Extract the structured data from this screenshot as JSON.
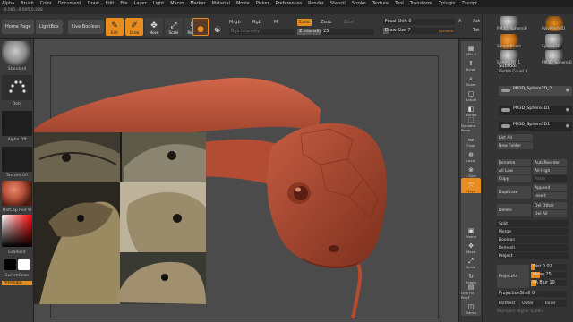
{
  "menu": [
    "Alpha",
    "Brush",
    "Color",
    "Document",
    "Draw",
    "Edit",
    "File",
    "Layer",
    "Light",
    "Macro",
    "Marker",
    "Material",
    "Movie",
    "Picker",
    "Preferences",
    "Render",
    "Stencil",
    "Stroke",
    "Texture",
    "Tool",
    "Transform",
    "Zplugin",
    "Zscript"
  ],
  "coords": "-0.081,-0.695,0.288",
  "toolbar": {
    "home": "Home Page",
    "lightbox": "LightBox",
    "live_boolean": "Live Boolean",
    "edit": "Edit",
    "draw": "Draw",
    "move": "Move",
    "scale": "Scale",
    "rotate": "Rotate",
    "mrgb": "Mrgb",
    "rgb": "Rgb",
    "m": "M",
    "rgb_intensity": "Rgb Intensity",
    "zadd": "Zadd",
    "zsub": "Zsub",
    "zcut": "Zcut",
    "z_intensity": "Z Intensity 25",
    "focal_shift": "Focal Shift 0",
    "draw_size": "Draw Size 7",
    "dynamic": "Dynamic",
    "a_lbl": "A",
    "tot_lbl": "Tot",
    "act_lbl": "Act"
  },
  "colors": {
    "accent": "#e78c1f",
    "clay": "#b8513a",
    "panel": "#343434",
    "canvas": "#4b4b4b"
  },
  "left_panel": {
    "standard": "Standard",
    "dots": "Dots",
    "alpha_off": "Alpha Off",
    "texture_off": "Texture Off",
    "matcap": "MatCap Red W",
    "gradient": "Gradient",
    "switch_color": "SwitchColor",
    "alternate": "Alternate"
  },
  "right_strip": [
    "SPix 3",
    "Scroll",
    "Zoom",
    "Actual",
    "AAHalf",
    "Dynamic Persp",
    "Floor",
    "Local",
    "L.Sym",
    "Qxyz",
    "",
    "",
    "Frame",
    "Move",
    "Scale",
    "Rotate",
    "Line Fill PolyF",
    "Transp"
  ],
  "right_panel": {
    "thumbs": [
      {
        "label": "PM3D_Sphere3I",
        "kind": "sphere"
      },
      {
        "label": "PolyMesh3D",
        "kind": "star"
      },
      {
        "label": "SimpleBrush",
        "kind": "brush"
      },
      {
        "label": "Sphere3D",
        "kind": "sphere"
      },
      {
        "label": "Sphere3D_1",
        "kind": "sphere"
      },
      {
        "label": "PM3D_Sphere3I",
        "kind": "sphere"
      }
    ],
    "subtool_title": "Subtool",
    "visible_count": "Visible Count 3",
    "subtools": [
      "PM3D_Sphere3D_2",
      "PM3D_Sphere3D1",
      "PM3D_Sphere3D1"
    ],
    "list_all": "List All",
    "new_folder": "New Folder",
    "rename": "Rename",
    "autoreorder": "AutoReorder",
    "all_low": "All Low",
    "all_high": "All High",
    "copy": "Copy",
    "paste": "Paste",
    "duplicate": "Duplicate",
    "append": "Append",
    "insert": "Insert",
    "delete": "Delete",
    "del_other": "Del Other",
    "del_all": "Del All",
    "split": "Split",
    "merge": "Merge",
    "boolean": "Boolean",
    "remesh": "Remesh",
    "project": "Project",
    "project_all": "ProjectAll",
    "dist": "Dist 0.02",
    "mean": "Mean 25",
    "pa_blur": "PA Blur 10",
    "projection_shell": "ProjectionShell 0",
    "farthest": "Farthest",
    "outer": "Outer",
    "inner": "Inner",
    "reproject": "Reproject Higher Subdiv"
  }
}
